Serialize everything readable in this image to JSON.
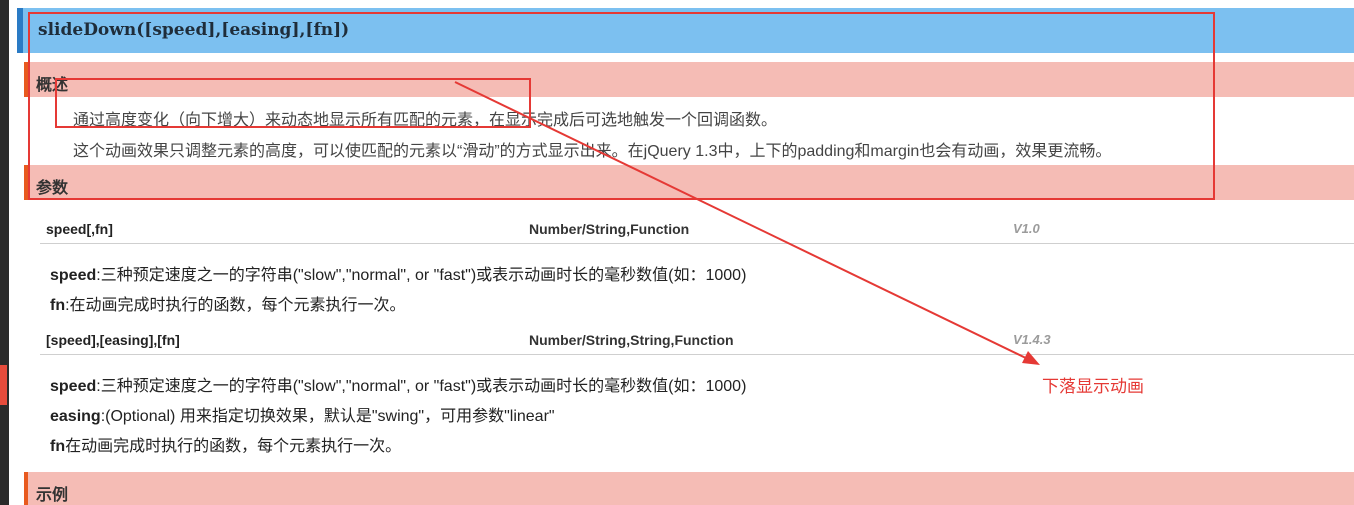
{
  "title": "slideDown([speed],[easing],[fn])",
  "sections": {
    "overview": "概述",
    "params": "参数",
    "example": "示例"
  },
  "overview": {
    "line1": "通过高度变化（向下增大）来动态地显示所有匹配的元素，在显示完成后可选地触发一个回调函数。",
    "line2": "这个动画效果只调整元素的高度，可以使匹配的元素以“滑动”的方式显示出来。在jQuery 1.3中，上下的padding和margin也会有动画，效果更流畅。"
  },
  "params": [
    {
      "name": "speed[,fn]",
      "type": "Number/String,Function",
      "version": "V1.0",
      "details": [
        {
          "key": "speed",
          "text": ":三种预定速度之一的字符串(\"slow\",\"normal\", or \"fast\")或表示动画时长的毫秒数值(如：1000)"
        },
        {
          "key": "fn",
          "text": ":在动画完成时执行的函数，每个元素执行一次。"
        }
      ]
    },
    {
      "name": "[speed],[easing],[fn]",
      "type": "Number/String,String,Function",
      "version": "V1.4.3",
      "details": [
        {
          "key": "speed",
          "text": ":三种预定速度之一的字符串(\"slow\",\"normal\", or \"fast\")或表示动画时长的毫秒数值(如：1000)"
        },
        {
          "key": "easing",
          "text": ":(Optional) 用来指定切换效果，默认是\"swing\"，可用参数\"linear\""
        },
        {
          "key": "fn",
          "text": "在动画完成时执行的函数，每个元素执行一次。"
        }
      ]
    }
  ],
  "annotation": {
    "label": "下落显示动画",
    "color": "#e53935"
  },
  "colors": {
    "title_bar": "#7cc0f0",
    "title_accent": "#2a7bc5",
    "section_bg": "#f5bcb5",
    "section_accent": "#e85a1f"
  }
}
